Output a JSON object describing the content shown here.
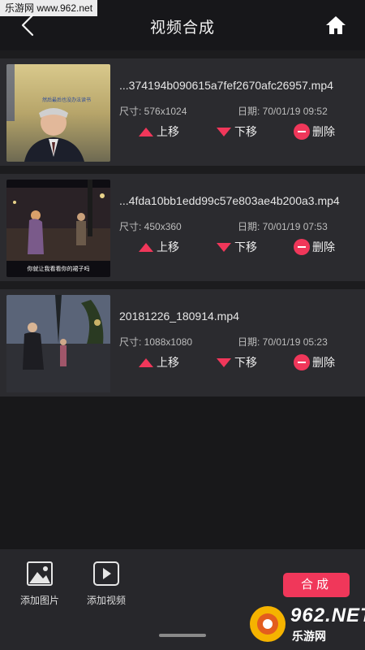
{
  "watermark": "乐游网 www.962.net",
  "header": {
    "title": "视频合成"
  },
  "videos": [
    {
      "filename": "...374194b090615a7fef2670afc26957.mp4",
      "size_label": "尺寸: 576x1024",
      "date_label": "日期: 70/01/19 09:52",
      "thumb_texts": [
        "然后最后也没办法读书"
      ]
    },
    {
      "filename": "...4fda10bb1edd99c57e803ae4b200a3.mp4",
      "size_label": "尺寸: 450x360",
      "date_label": "日期: 70/01/19 07:53",
      "thumb_texts": [
        "你就让我看看你的裙子吗"
      ]
    },
    {
      "filename": "20181226_180914.mp4",
      "size_label": "尺寸: 1088x1080",
      "date_label": "日期: 70/01/19 05:23",
      "thumb_texts": []
    }
  ],
  "actions": {
    "up": "上移",
    "down": "下移",
    "delete": "删除"
  },
  "bottom": {
    "add_image": "添加图片",
    "add_video": "添加视频",
    "merge": "合成"
  },
  "brand": {
    "number": "962",
    "suffix": ".NET",
    "name": "乐游网"
  },
  "colors": {
    "accent": "#f0375a",
    "background": "#1c1c1e",
    "card": "#2b2b2f"
  }
}
